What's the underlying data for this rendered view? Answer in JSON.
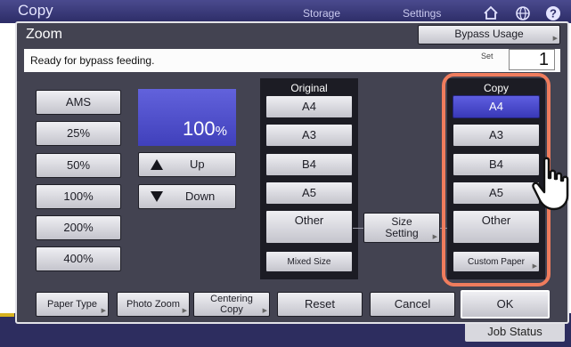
{
  "background": {
    "title": "Copy",
    "tabs": [
      "Storage",
      "Settings"
    ],
    "icons": [
      "home-icon",
      "globe-icon",
      "help-icon"
    ],
    "job_status": "Job Status"
  },
  "dialog": {
    "title": "Zoom",
    "bypass_button": "Bypass Usage",
    "status_message": "Ready for bypass feeding.",
    "set_label": "Set",
    "set_value": "1"
  },
  "zoom_presets": [
    "AMS",
    "25%",
    "50%",
    "100%",
    "200%",
    "400%"
  ],
  "zoom_display": {
    "value": "100",
    "unit": "%"
  },
  "up_label": "Up",
  "down_label": "Down",
  "original": {
    "label": "Original",
    "sizes": [
      "A4",
      "A3",
      "B4",
      "A5",
      "Other",
      "Mixed Size"
    ]
  },
  "size_setting_label": [
    "Size",
    "Setting"
  ],
  "copy": {
    "label": "Copy",
    "sizes": [
      "A4",
      "A3",
      "B4",
      "A5",
      "Other",
      "Custom Paper"
    ],
    "selected": "A4"
  },
  "bottom_buttons": {
    "paper_type": "Paper Type",
    "photo_zoom": "Photo Zoom",
    "centering_copy": [
      "Centering",
      "Copy"
    ],
    "reset": "Reset",
    "cancel": "Cancel",
    "ok": "OK"
  },
  "colors": {
    "dialog_bg": "#434351",
    "selected_blue": "#4a4acc",
    "highlight": "#ef7c5d"
  }
}
